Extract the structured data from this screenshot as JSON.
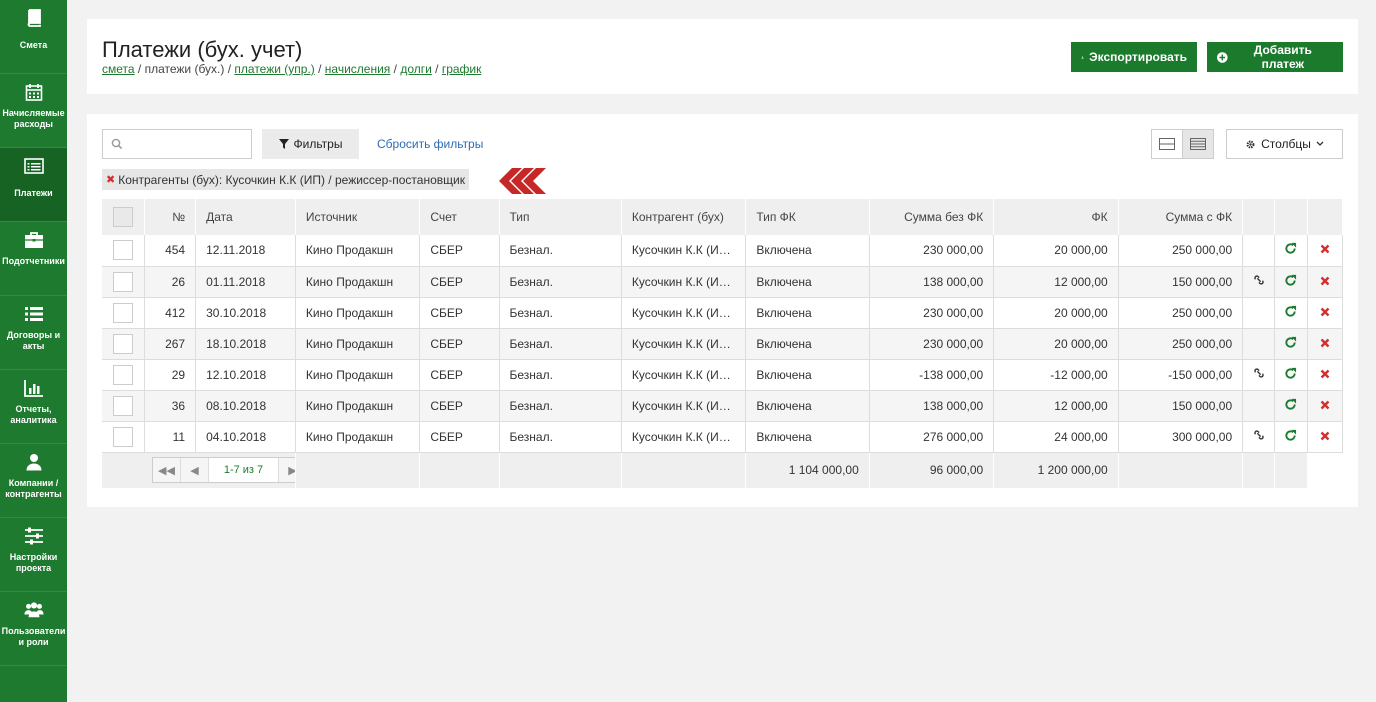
{
  "sidebar": {
    "items": [
      {
        "label": "Смета",
        "icon": "book-icon",
        "active": false
      },
      {
        "label": "Начисляемые расходы",
        "icon": "calendar-icon",
        "active": false
      },
      {
        "label": "Платежи",
        "icon": "list-alt-icon",
        "active": true
      },
      {
        "label": "Подотчетники",
        "icon": "briefcase-icon",
        "active": false
      },
      {
        "label": "Договоры и акты",
        "icon": "list-icon",
        "active": false
      },
      {
        "label": "Отчеты, аналитика",
        "icon": "bar-chart-icon",
        "active": false
      },
      {
        "label": "Компании / контрагенты",
        "icon": "user-icon",
        "active": false
      },
      {
        "label": "Настройки проекта",
        "icon": "sliders-icon",
        "active": false
      },
      {
        "label": "Пользователи и роли",
        "icon": "users-icon",
        "active": false
      }
    ]
  },
  "header": {
    "title": "Платежи (бух. учет)",
    "breadcrumbs": [
      {
        "label": "смета",
        "link": true
      },
      {
        "label": "платежи (бух.)",
        "link": false
      },
      {
        "label": "платежи (упр.)",
        "link": true
      },
      {
        "label": "начисления",
        "link": true
      },
      {
        "label": "долги",
        "link": true
      },
      {
        "label": "график",
        "link": true
      }
    ],
    "export_label": "Экспортировать",
    "add_label": "Добавить платеж"
  },
  "toolbar": {
    "search_placeholder": "",
    "search_value": "",
    "filters_label": "Фильтры",
    "reset_label": "Сбросить фильтры",
    "columns_label": "Столбцы"
  },
  "active_filter": {
    "label": "Контрагенты (бух):",
    "value": "Кусочкин К.К (ИП) / режиссер-постановщик"
  },
  "table": {
    "columns": [
      "№",
      "Дата",
      "Источник",
      "Счет",
      "Тип",
      "Контрагент (бух)",
      "Тип ФК",
      "Сумма без ФК",
      "ФК",
      "Сумма с ФК"
    ],
    "rows": [
      {
        "num": "454",
        "date": "12.11.2018",
        "source": "Кино Продакшн",
        "account": "СБЕР",
        "type": "Безнал.",
        "counterparty": "Кусочкин К.К (ИП) / режиссер-постановщик",
        "fk_type": "Включена",
        "sum_without": "230 000,00",
        "fk": "20 000,00",
        "sum_with": "250 000,00",
        "linked": false
      },
      {
        "num": "26",
        "date": "01.11.2018",
        "source": "Кино Продакшн",
        "account": "СБЕР",
        "type": "Безнал.",
        "counterparty": "Кусочкин К.К (ИП) / режиссер-постановщик",
        "fk_type": "Включена",
        "sum_without": "138 000,00",
        "fk": "12 000,00",
        "sum_with": "150 000,00",
        "linked": true
      },
      {
        "num": "412",
        "date": "30.10.2018",
        "source": "Кино Продакшн",
        "account": "СБЕР",
        "type": "Безнал.",
        "counterparty": "Кусочкин К.К (ИП) / режиссер-постановщик",
        "fk_type": "Включена",
        "sum_without": "230 000,00",
        "fk": "20 000,00",
        "sum_with": "250 000,00",
        "linked": false
      },
      {
        "num": "267",
        "date": "18.10.2018",
        "source": "Кино Продакшн",
        "account": "СБЕР",
        "type": "Безнал.",
        "counterparty": "Кусочкин К.К (ИП) / режиссер-постановщик",
        "fk_type": "Включена",
        "sum_without": "230 000,00",
        "fk": "20 000,00",
        "sum_with": "250 000,00",
        "linked": false
      },
      {
        "num": "29",
        "date": "12.10.2018",
        "source": "Кино Продакшн",
        "account": "СБЕР",
        "type": "Безнал.",
        "counterparty": "Кусочкин К.К (ИП) / режиссер-постановщик",
        "fk_type": "Включена",
        "sum_without": "-138 000,00",
        "fk": "-12 000,00",
        "sum_with": "-150 000,00",
        "linked": true
      },
      {
        "num": "36",
        "date": "08.10.2018",
        "source": "Кино Продакшн",
        "account": "СБЕР",
        "type": "Безнал.",
        "counterparty": "Кусочкин К.К (ИП) / режиссер-постановщик",
        "fk_type": "Включена",
        "sum_without": "138 000,00",
        "fk": "12 000,00",
        "sum_with": "150 000,00",
        "linked": false
      },
      {
        "num": "11",
        "date": "04.10.2018",
        "source": "Кино Продакшн",
        "account": "СБЕР",
        "type": "Безнал.",
        "counterparty": "Кусочкин К.К (ИП) / режиссер-постановщик",
        "fk_type": "Включена",
        "sum_without": "276 000,00",
        "fk": "24 000,00",
        "sum_with": "300 000,00",
        "linked": true
      }
    ],
    "totals": {
      "sum_without": "1 104 000,00",
      "fk": "96 000,00",
      "sum_with": "1 200 000,00"
    },
    "pagination": "1-7 из 7"
  },
  "colors": {
    "brand_green": "#1d7a2e",
    "link_blue": "#2a6db5",
    "delete_red": "#d32f2f",
    "chevron_red": "#c62828"
  }
}
